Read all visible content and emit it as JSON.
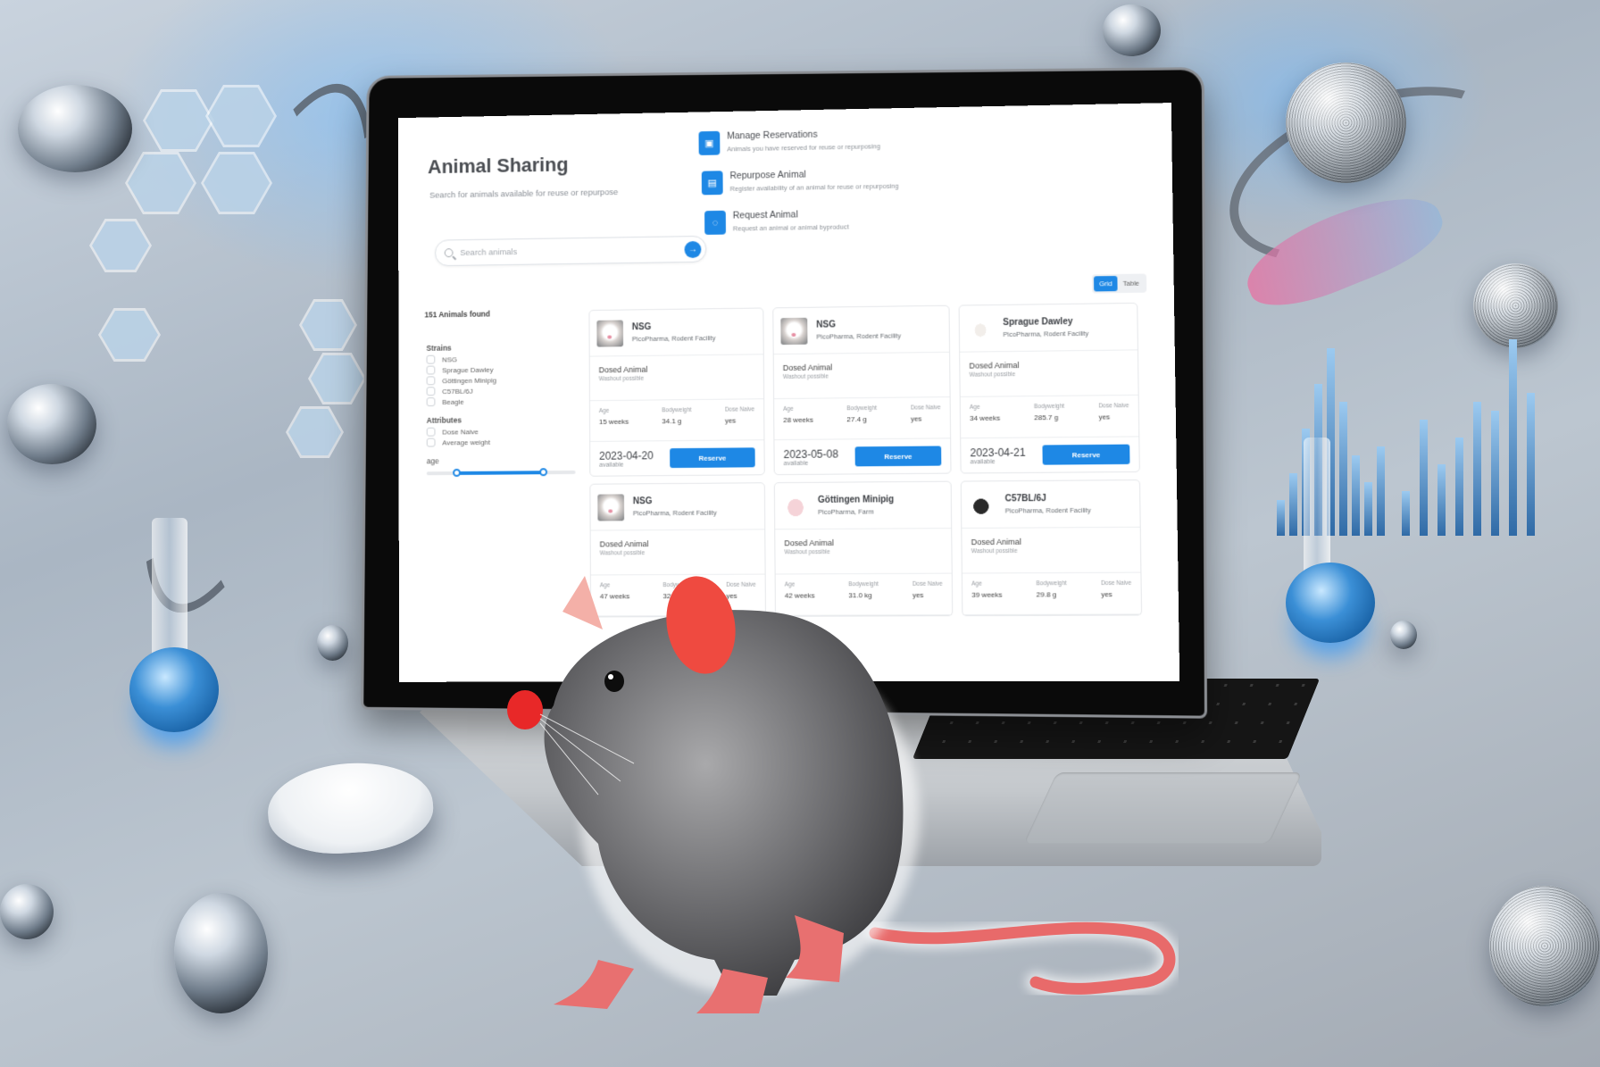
{
  "app": {
    "title": "Animal Sharing",
    "subtitle": "Search for animals available for reuse or repurpose",
    "accent_color": "#1e88e5"
  },
  "search": {
    "placeholder": "Search animals",
    "value": "",
    "icon": "search-icon",
    "submit_icon": "arrow-right-icon"
  },
  "actions": [
    {
      "title": "Manage Reservations",
      "description": "Animals you have reserved for reuse or repurposing",
      "icon": "reservation-icon"
    },
    {
      "title": "Repurpose Animal",
      "description": "Register availability of an animal for reuse or repurposing",
      "icon": "document-icon"
    },
    {
      "title": "Request Animal",
      "description": "Request an animal or animal byproduct",
      "icon": "request-icon"
    }
  ],
  "view_toggle": {
    "options": [
      "Grid",
      "Table"
    ],
    "selected": "Grid"
  },
  "results": {
    "count_label": "151 Animals found"
  },
  "filters": {
    "strains": {
      "heading": "Strains",
      "options": [
        "NSG",
        "Sprague Dawley",
        "Göttingen Minipig",
        "C57BL/6J",
        "Beagle"
      ]
    },
    "attributes": {
      "heading": "Attributes",
      "options": [
        "Dose Naive",
        "Average weight"
      ]
    },
    "age": {
      "label": "age",
      "range_fraction": [
        0.2,
        0.78
      ]
    }
  },
  "card_labels": {
    "age": "Age",
    "bodyweight": "Bodyweight",
    "dose_naive": "Dose Naive",
    "available": "available",
    "reserve": "Reserve"
  },
  "animals": [
    {
      "strain": "NSG",
      "facility": "PicoPharma, Rodent Facility",
      "status": "Dosed Animal",
      "status_note": "Washout possible",
      "age": "15 weeks",
      "bodyweight": "34.1 g",
      "dose_naive": "yes",
      "available_date": "2023-04-20",
      "thumb": "white-mouse"
    },
    {
      "strain": "NSG",
      "facility": "PicoPharma, Rodent Facility",
      "status": "Dosed Animal",
      "status_note": "Washout possible",
      "age": "28 weeks",
      "bodyweight": "27.4 g",
      "dose_naive": "yes",
      "available_date": "2023-05-08",
      "thumb": "white-mouse"
    },
    {
      "strain": "Sprague Dawley",
      "facility": "PicoPharma, Rodent Facility",
      "status": "Dosed Animal",
      "status_note": "Washout possible",
      "age": "34 weeks",
      "bodyweight": "285.7 g",
      "dose_naive": "yes",
      "available_date": "2023-04-21",
      "thumb": "white-rat"
    },
    {
      "strain": "NSG",
      "facility": "PicoPharma, Rodent Facility",
      "status": "Dosed Animal",
      "status_note": "Washout possible",
      "age": "47 weeks",
      "bodyweight": "32.0 g",
      "dose_naive": "yes",
      "thumb": "white-mouse"
    },
    {
      "strain": "Göttingen Minipig",
      "facility": "PicoPharma, Farm",
      "status": "Dosed Animal",
      "status_note": "Washout possible",
      "age": "42 weeks",
      "bodyweight": "31.0 kg",
      "dose_naive": "yes",
      "thumb": "pig"
    },
    {
      "strain": "C57BL/6J",
      "facility": "PicoPharma, Rodent Facility",
      "status": "Dosed Animal",
      "status_note": "Washout possible",
      "age": "39 weeks",
      "bodyweight": "29.8 g",
      "dose_naive": "yes",
      "thumb": "black-mouse"
    }
  ]
}
